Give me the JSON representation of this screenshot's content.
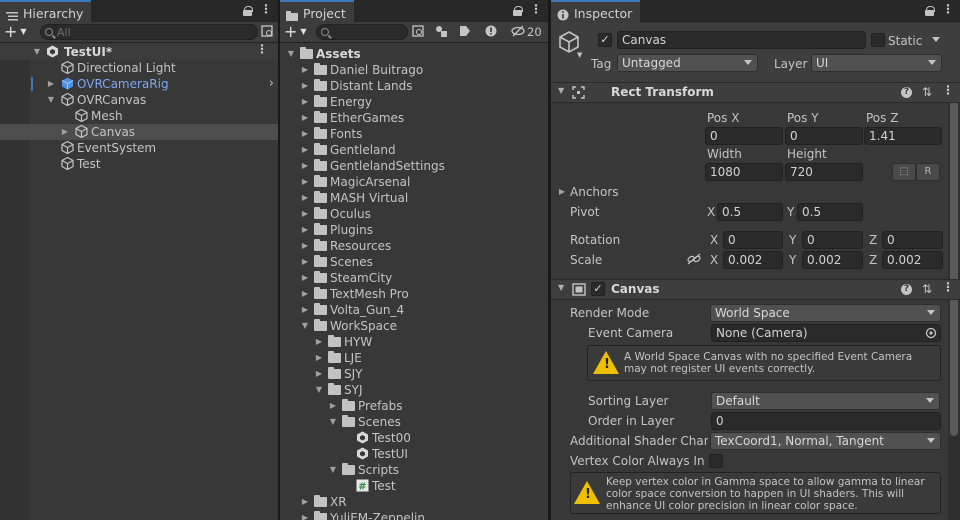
{
  "hierarchy": {
    "tab_label": "Hierarchy",
    "search_placeholder": "All",
    "items": [
      {
        "label": "TestUI*"
      },
      {
        "label": "Directional Light"
      },
      {
        "label": "OVRCameraRig"
      },
      {
        "label": "OVRCanvas"
      },
      {
        "label": "Mesh"
      },
      {
        "label": "Canvas"
      },
      {
        "label": "EventSystem"
      },
      {
        "label": "Test"
      }
    ]
  },
  "project": {
    "tab_label": "Project",
    "hidden_count": "20",
    "items": [
      {
        "label": "Assets"
      },
      {
        "label": "Daniel Buitrago"
      },
      {
        "label": "Distant Lands"
      },
      {
        "label": "Energy"
      },
      {
        "label": "EtherGames"
      },
      {
        "label": "Fonts"
      },
      {
        "label": "Gentleland"
      },
      {
        "label": "GentlelandSettings"
      },
      {
        "label": "MagicArsenal"
      },
      {
        "label": "MASH Virtual"
      },
      {
        "label": "Oculus"
      },
      {
        "label": "Plugins"
      },
      {
        "label": "Resources"
      },
      {
        "label": "Scenes"
      },
      {
        "label": "SteamCity"
      },
      {
        "label": "TextMesh Pro"
      },
      {
        "label": "Volta_Gun_4"
      },
      {
        "label": "WorkSpace"
      },
      {
        "label": "HYW"
      },
      {
        "label": "LJE"
      },
      {
        "label": "SJY"
      },
      {
        "label": "SYJ"
      },
      {
        "label": "Prefabs"
      },
      {
        "label": "Scenes"
      },
      {
        "label": "Test00"
      },
      {
        "label": "TestUI"
      },
      {
        "label": "Scripts"
      },
      {
        "label": "Test"
      },
      {
        "label": "XR"
      },
      {
        "label": "YuliEM-Zeppelin"
      }
    ]
  },
  "inspector": {
    "tab_label": "Inspector",
    "object_name": "Canvas",
    "static_label": "Static",
    "tag_label": "Tag",
    "tag_value": "Untagged",
    "layer_label": "Layer",
    "layer_value": "UI",
    "rect_transform": {
      "title": "Rect Transform",
      "pos_x_label": "Pos X",
      "pos_x": "0",
      "pos_y_label": "Pos Y",
      "pos_y": "0",
      "pos_z_label": "Pos Z",
      "pos_z": "1.41",
      "width_label": "Width",
      "width": "1080",
      "height_label": "Height",
      "height": "720",
      "anchors_label": "Anchors",
      "pivot_label": "Pivot",
      "pivot_x": "0.5",
      "pivot_y": "0.5",
      "rotation_label": "Rotation",
      "rot_x": "0",
      "rot_y": "0",
      "rot_z": "0",
      "scale_label": "Scale",
      "scale_x": "0.002",
      "scale_y": "0.002",
      "scale_z": "0.002",
      "x": "X",
      "y": "Y",
      "z": "Z"
    },
    "canvas": {
      "title": "Canvas",
      "render_mode_label": "Render Mode",
      "render_mode": "World Space",
      "event_camera_label": "Event Camera",
      "event_camera": "None (Camera)",
      "warning": "A World Space Canvas with no specified Event Camera may not register UI events correctly.",
      "sorting_layer_label": "Sorting Layer",
      "sorting_layer": "Default",
      "order_label": "Order in Layer",
      "order": "0",
      "shader_label": "Additional Shader Chann",
      "shader_value": "TexCoord1, Normal, Tangent",
      "vertex_label": "Vertex Color Always In G",
      "info": "Keep vertex color in Gamma space to allow gamma to linear color space conversion to happen in UI shaders. This will enhance UI color precision in linear color space."
    }
  }
}
